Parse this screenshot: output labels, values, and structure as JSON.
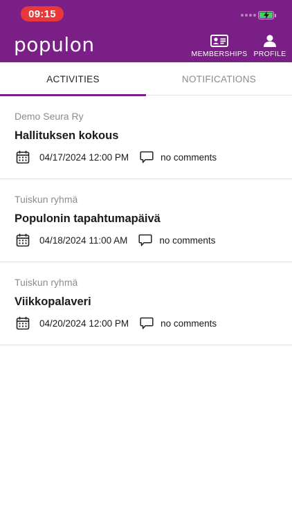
{
  "status_bar": {
    "time": "09:15"
  },
  "header": {
    "logo": "populon",
    "nav": [
      {
        "label": "MEMBERSHIPS",
        "icon": "id-card-icon"
      },
      {
        "label": "PROFILE",
        "icon": "person-icon"
      }
    ]
  },
  "tabs": [
    {
      "label": "ACTIVITIES",
      "active": true
    },
    {
      "label": "NOTIFICATIONS",
      "active": false
    }
  ],
  "activities": [
    {
      "organization": "Demo Seura Ry",
      "title": "Hallituksen kokous",
      "datetime": "04/17/2024 12:00 PM",
      "comments": "no comments"
    },
    {
      "organization": "Tuiskun ryhmä",
      "title": "Populonin tapahtumapäivä",
      "datetime": "04/18/2024 11:00 AM",
      "comments": "no comments"
    },
    {
      "organization": "Tuiskun ryhmä",
      "title": "Viikkopalaveri",
      "datetime": "04/20/2024 12:00 PM",
      "comments": "no comments"
    }
  ],
  "colors": {
    "brand": "#7a1f86",
    "status_time_bg": "#e8383c",
    "battery": "#3fd45a"
  }
}
